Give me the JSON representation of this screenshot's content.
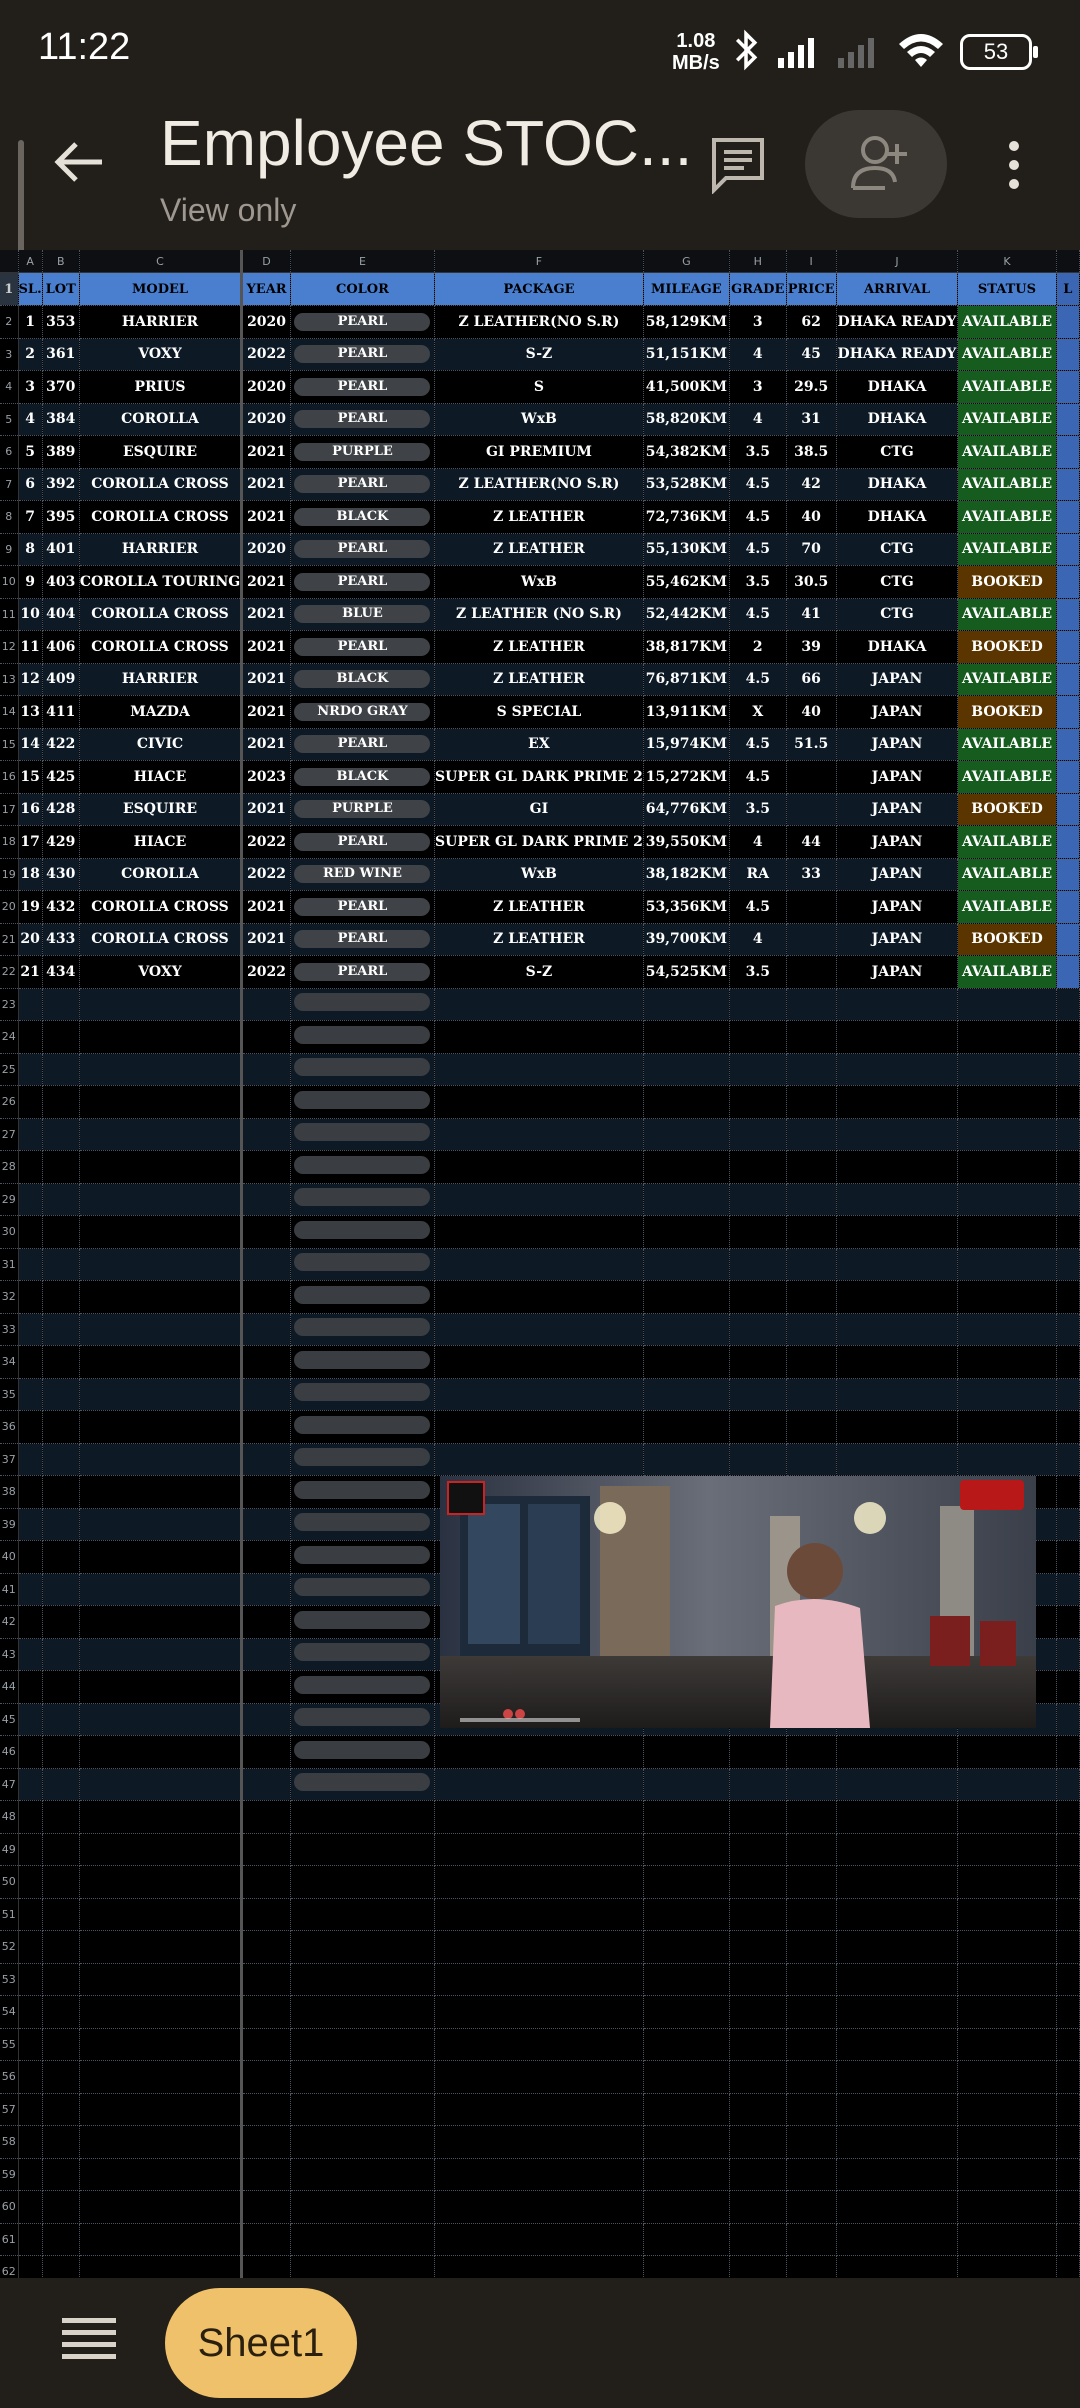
{
  "status_bar": {
    "time": "11:22",
    "speed_top": "1.08",
    "speed_bottom": "MB/s",
    "battery": "53"
  },
  "app_bar": {
    "title": "Employee STOC...",
    "subtitle": "View only"
  },
  "columns": [
    "A",
    "B",
    "C",
    "D",
    "E",
    "F",
    "G",
    "H",
    "I",
    "J",
    "K"
  ],
  "headers": [
    "SL.",
    "LOT",
    "MODEL",
    "YEAR",
    "COLOR",
    "PACKAGE",
    "MILEAGE",
    "GRADE",
    "PRICE",
    "ARRIVAL",
    "STATUS",
    "L"
  ],
  "rows": [
    [
      "1",
      "353",
      "HARRIER",
      "2020",
      "PEARL",
      "Z LEATHER(NO S.R)",
      "58,129KM",
      "3",
      "62",
      "DHAKA READY",
      "AVAILABLE"
    ],
    [
      "2",
      "361",
      "VOXY",
      "2022",
      "PEARL",
      "S-Z",
      "51,151KM",
      "4",
      "45",
      "DHAKA READY",
      "AVAILABLE"
    ],
    [
      "3",
      "370",
      "PRIUS",
      "2020",
      "PEARL",
      "S",
      "41,500KM",
      "3",
      "29.5",
      "DHAKA",
      "AVAILABLE"
    ],
    [
      "4",
      "384",
      "COROLLA",
      "2020",
      "PEARL",
      "WxB",
      "58,820KM",
      "4",
      "31",
      "DHAKA",
      "AVAILABLE"
    ],
    [
      "5",
      "389",
      "ESQUIRE",
      "2021",
      "PURPLE",
      "GI PREMIUM",
      "54,382KM",
      "3.5",
      "38.5",
      "CTG",
      "AVAILABLE"
    ],
    [
      "6",
      "392",
      "COROLLA CROSS",
      "2021",
      "PEARL",
      "Z LEATHER(NO S.R)",
      "53,528KM",
      "4.5",
      "42",
      "DHAKA",
      "AVAILABLE"
    ],
    [
      "7",
      "395",
      "COROLLA CROSS",
      "2021",
      "BLACK",
      "Z LEATHER",
      "72,736KM",
      "4.5",
      "40",
      "DHAKA",
      "AVAILABLE"
    ],
    [
      "8",
      "401",
      "HARRIER",
      "2020",
      "PEARL",
      "Z LEATHER",
      "55,130KM",
      "4.5",
      "70",
      "CTG",
      "AVAILABLE"
    ],
    [
      "9",
      "403",
      "COROLLA TOURING",
      "2021",
      "PEARL",
      "WxB",
      "55,462KM",
      "3.5",
      "30.5",
      "CTG",
      "BOOKED"
    ],
    [
      "10",
      "404",
      "COROLLA CROSS",
      "2021",
      "BLUE",
      "Z LEATHER (NO S.R)",
      "52,442KM",
      "4.5",
      "41",
      "CTG",
      "AVAILABLE"
    ],
    [
      "11",
      "406",
      "COROLLA CROSS",
      "2021",
      "PEARL",
      "Z LEATHER",
      "38,817KM",
      "2",
      "39",
      "DHAKA",
      "BOOKED"
    ],
    [
      "12",
      "409",
      "HARRIER",
      "2021",
      "BLACK",
      "Z LEATHER",
      "76,871KM",
      "4.5",
      "66",
      "JAPAN",
      "AVAILABLE"
    ],
    [
      "13",
      "411",
      "MAZDA",
      "2021",
      "NRDO GRAY",
      "S SPECIAL",
      "13,911KM",
      "X",
      "40",
      "JAPAN",
      "BOOKED"
    ],
    [
      "14",
      "422",
      "CIVIC",
      "2021",
      "PEARL",
      "EX",
      "15,974KM",
      "4.5",
      "51.5",
      "JAPAN",
      "AVAILABLE"
    ],
    [
      "15",
      "425",
      "HIACE",
      "2023",
      "BLACK",
      "SUPER GL DARK PRIME 2",
      "15,272KM",
      "4.5",
      "",
      "JAPAN",
      "AVAILABLE"
    ],
    [
      "16",
      "428",
      "ESQUIRE",
      "2021",
      "PURPLE",
      "GI",
      "64,776KM",
      "3.5",
      "",
      "JAPAN",
      "BOOKED"
    ],
    [
      "17",
      "429",
      "HIACE",
      "2022",
      "PEARL",
      "SUPER GL DARK PRIME 2",
      "39,550KM",
      "4",
      "44",
      "JAPAN",
      "AVAILABLE"
    ],
    [
      "18",
      "430",
      "COROLLA",
      "2022",
      "RED WINE",
      "WxB",
      "38,182KM",
      "RA",
      "33",
      "JAPAN",
      "AVAILABLE"
    ],
    [
      "19",
      "432",
      "COROLLA CROSS",
      "2021",
      "PEARL",
      "Z LEATHER",
      "53,356KM",
      "4.5",
      "",
      "JAPAN",
      "AVAILABLE"
    ],
    [
      "20",
      "433",
      "COROLLA CROSS",
      "2021",
      "PEARL",
      "Z LEATHER",
      "39,700KM",
      "4",
      "",
      "JAPAN",
      "BOOKED"
    ],
    [
      "21",
      "434",
      "VOXY",
      "2022",
      "PEARL",
      "S-Z",
      "54,525KM",
      "3.5",
      "",
      "JAPAN",
      "AVAILABLE"
    ]
  ],
  "row_numbers_start": 2,
  "blank_rows_from": 23,
  "blank_rows_to": 62,
  "pill_rows_to": 47,
  "bottom_bar": {
    "sheet_tab": "Sheet1"
  },
  "colors": {
    "header_blue": "#4a7fd0",
    "available_green": "#155c1e",
    "booked_brown": "#5a3500",
    "sheet_tab": "#efc16a"
  }
}
